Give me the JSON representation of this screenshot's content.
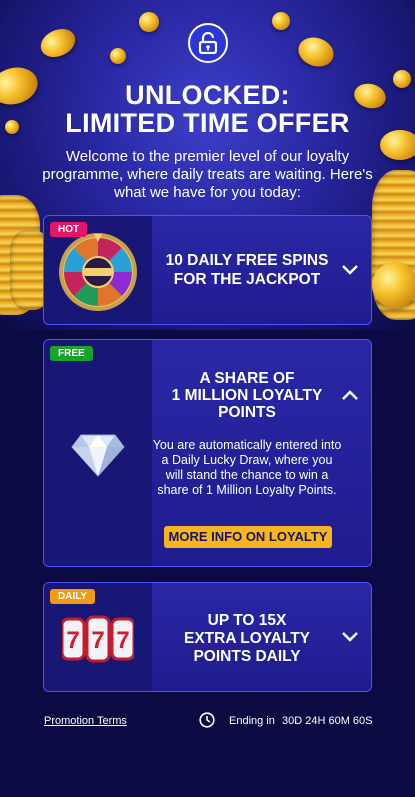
{
  "header": {
    "title_line1": "UNLOCKED:",
    "title_line2": "LIMITED TIME OFFER",
    "intro": "Welcome to the premier level of our loyalty programme, where daily treats are waiting. Here's what we have for you today:"
  },
  "cards": [
    {
      "tag": "HOT",
      "tag_color": "#e5156a",
      "title_line1": "10 DAILY FREE SPINS",
      "title_line2": "FOR THE JACKPOT",
      "expanded": false,
      "image": "money-wheel"
    },
    {
      "tag": "FREE",
      "tag_color": "#1aa32a",
      "title_line1": "A SHARE OF",
      "title_line2": "1 MILLION LOYALTY",
      "title_line3": "POINTS",
      "expanded": true,
      "image": "diamond",
      "description": "You are automatically entered into a Daily Lucky Draw, where you will stand the chance to win a share of 1 Million Loyalty Points.",
      "button": "MORE INFO ON LOYALTY"
    },
    {
      "tag": "DAILY",
      "tag_color": "#f29a12",
      "title_line1": "UP TO 15X",
      "title_line2": "EXTRA LOYALTY",
      "title_line3": "POINTS DAILY",
      "expanded": false,
      "image": "slot-777",
      "slot_digits": [
        "7",
        "7",
        "7"
      ]
    }
  ],
  "footer": {
    "terms": "Promotion Terms",
    "ending_label": "Ending in",
    "countdown": "30D 24H 60M 60S"
  },
  "colors": {
    "card_border": "#4d54ff",
    "button": "#f6b51d",
    "background": "#0c0a43"
  },
  "icons": [
    "unlock-icon",
    "chevron-down-icon",
    "chevron-up-icon",
    "clock-icon"
  ]
}
